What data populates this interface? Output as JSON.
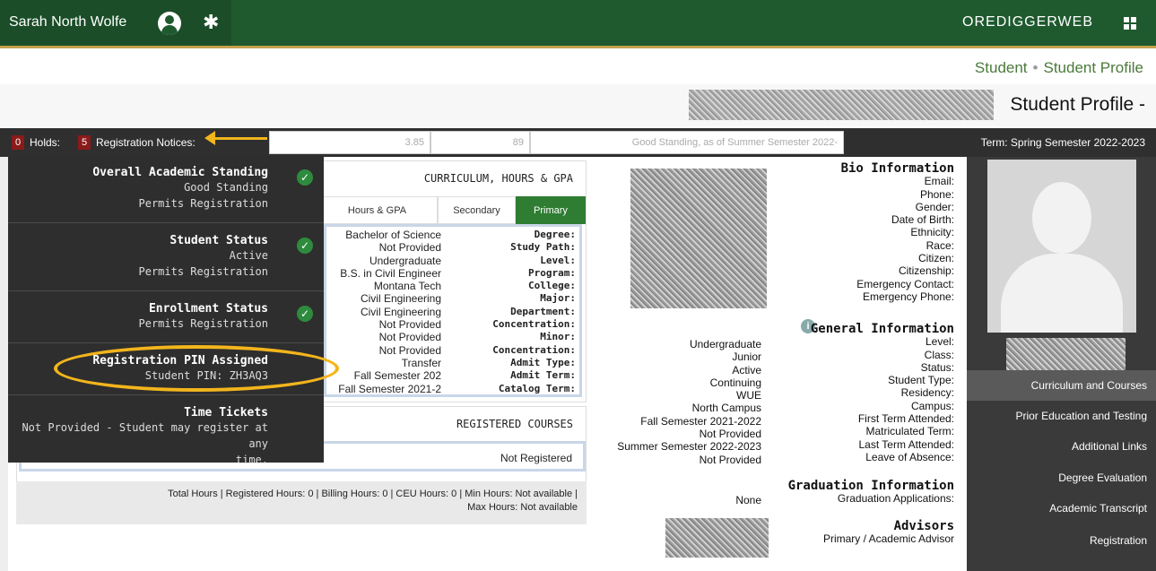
{
  "app": {
    "name": "OREDIGGERWEB"
  },
  "user": {
    "name": "Sarah North Wolfe"
  },
  "breadcrumb": {
    "home": "Student",
    "current": "Student Profile"
  },
  "page": {
    "title": "Student Profile -"
  },
  "termbar": {
    "term": "Term: Spring Semester 2022-2023",
    "standing": "Good Standing, as of Summer Semester 2022-",
    "credits": "89",
    "gpa": "3.85",
    "registration_notices_label": "Registration Notices:",
    "registration_notices_count": "5",
    "holds_label": "Holds:",
    "holds_count": "0"
  },
  "sidebar": {
    "items": [
      {
        "label": "Curriculum and Courses",
        "active": true
      },
      {
        "label": "Prior Education and Testing"
      },
      {
        "label": "Additional Links"
      },
      {
        "label": "Degree Evaluation"
      },
      {
        "label": "Academic Transcript"
      },
      {
        "label": "Registration"
      }
    ]
  },
  "bio": {
    "heading": "Bio Information",
    "fields": [
      "Email:",
      "Phone:",
      "Gender:",
      "Date of Birth:",
      "Ethnicity:",
      "Race:",
      "Citizen:",
      "Citizenship:",
      "Emergency Contact:",
      "Emergency Phone:"
    ]
  },
  "general": {
    "heading": "General Information",
    "rows": [
      {
        "label": "Level:",
        "value": "Undergraduate"
      },
      {
        "label": "Class:",
        "value": "Junior"
      },
      {
        "label": "Status:",
        "value": "Active"
      },
      {
        "label": "Student Type:",
        "value": "Continuing"
      },
      {
        "label": "Residency:",
        "value": "WUE"
      },
      {
        "label": "Campus:",
        "value": "North Campus"
      },
      {
        "label": "First Term Attended:",
        "value": "Fall Semester 2021-2022"
      },
      {
        "label": "Matriculated Term:",
        "value": "Not Provided"
      },
      {
        "label": "Last Term Attended:",
        "value": "Summer Semester 2022-2023"
      },
      {
        "label": "Leave of Absence:",
        "value": "Not Provided"
      }
    ]
  },
  "graduation": {
    "heading": "Graduation Information",
    "label": "Graduation Applications:",
    "value": "None"
  },
  "advisors": {
    "heading": "Advisors",
    "label": "Primary / Academic Advisor"
  },
  "curriculum": {
    "heading": "CURRICULUM, HOURS & GPA",
    "tabs": [
      "Primary",
      "Secondary",
      "Hours & GPA"
    ],
    "rows": [
      {
        "label": "Degree:",
        "value": "Bachelor of Science"
      },
      {
        "label": "Study Path:",
        "value": "Not Provided"
      },
      {
        "label": "Level:",
        "value": "Undergraduate"
      },
      {
        "label": "Program:",
        "value": "B.S. in Civil Engineer"
      },
      {
        "label": "College:",
        "value": "Montana Tech"
      },
      {
        "label": "Major:",
        "value": "Civil Engineering"
      },
      {
        "label": "Department:",
        "value": "Civil Engineering"
      },
      {
        "label": "Concentration:",
        "value": "Not Provided"
      },
      {
        "label": "Minor:",
        "value": "Not Provided"
      },
      {
        "label": "Concentration:",
        "value": "Not Provided"
      },
      {
        "label": "Admit Type:",
        "value": "Transfer"
      },
      {
        "label": "Admit Term:",
        "value": "Fall Semester 202"
      },
      {
        "label": "Catalog Term:",
        "value": "Fall Semester 2021-2"
      }
    ]
  },
  "registered": {
    "heading": "REGISTERED COURSES",
    "status": "Not Registered",
    "hours_line1": "Total Hours | Registered Hours: 0 | Billing Hours: 0 | CEU Hours: 0 | Min Hours: Not available |",
    "hours_line2": "Max Hours: Not available"
  },
  "overlay": {
    "items": [
      {
        "title": "Overall Academic Standing",
        "lines": [
          "Good Standing",
          "Permits Registration"
        ]
      },
      {
        "title": "Student Status",
        "lines": [
          "Active",
          "Permits Registration"
        ]
      },
      {
        "title": "Enrollment Status",
        "lines": [
          "Permits Registration"
        ]
      },
      {
        "title": "Registration PIN Assigned",
        "lines": [
          "Student PIN: ZH3AQ3"
        ]
      },
      {
        "title": "Time Tickets",
        "lines": [
          "Not Provided - Student may register at any",
          "time."
        ]
      }
    ]
  },
  "colors": {
    "header": "#1f5a2f",
    "accent": "#f2b51c",
    "active_tab": "#2e7d32",
    "badge": "#8b1a1a"
  }
}
